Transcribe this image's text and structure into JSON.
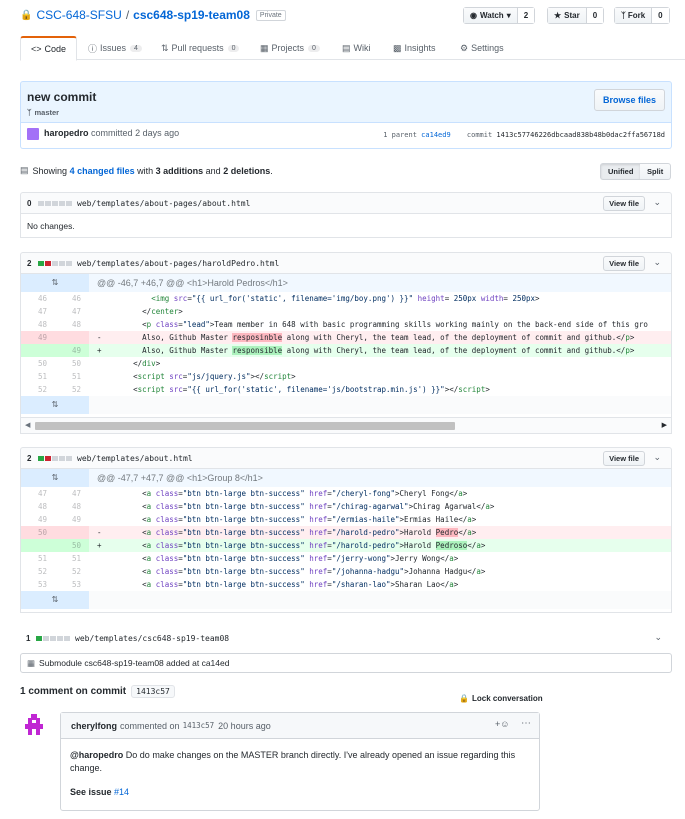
{
  "repo": {
    "owner": "CSC-648-SFSU",
    "sep": "/",
    "name": "csc648-sp19-team08",
    "visibility": "Private"
  },
  "actions": {
    "watch_label": "Watch",
    "watch_count": "2",
    "star_label": "Star",
    "star_count": "0",
    "fork_label": "Fork",
    "fork_count": "0"
  },
  "tabs": [
    {
      "label": "Code",
      "count": ""
    },
    {
      "label": "Issues",
      "count": "4"
    },
    {
      "label": "Pull requests",
      "count": "0"
    },
    {
      "label": "Projects",
      "count": "0"
    },
    {
      "label": "Wiki",
      "count": ""
    },
    {
      "label": "Insights",
      "count": ""
    },
    {
      "label": "Settings",
      "count": ""
    }
  ],
  "commit": {
    "title": "new commit",
    "branch": "master",
    "browse_label": "Browse files",
    "author": "haropedro",
    "committed_text": "committed",
    "time": "2 days ago",
    "parent_text": "1 parent",
    "parent_sha": "ca14ed9",
    "commit_label": "commit",
    "sha": "1413c57746226dbcaad838b48b0dac2ffa56718d"
  },
  "summary": {
    "showing": "Showing",
    "changed": "4 changed files",
    "with": "with",
    "additions": "3 additions",
    "and": "and",
    "deletions": "2 deletions",
    "end": "."
  },
  "view_toggle": {
    "unified": "Unified",
    "split": "Split"
  },
  "view_file_label": "View file",
  "files": [
    {
      "count": "0",
      "name": "web/templates/about-pages/about.html",
      "note": "No changes."
    },
    {
      "count": "2",
      "name": "web/templates/about-pages/haroldPedro.html",
      "hunk": "@@ -46,7 +46,7 @@ <h1>Harold Pedros</h1>"
    },
    {
      "count": "2",
      "name": "web/templates/about.html",
      "hunk": "@@ -47,7 +47,7 @@ <h1>Group 8</h1>"
    },
    {
      "count": "1",
      "name": "web/templates/csc648-sp19-team08",
      "note": "Submodule csc648-sp19-team08 added at ca14ed"
    }
  ],
  "comments": {
    "heading": "1 comment on commit",
    "sha": "1413c57",
    "lock_label": "Lock conversation",
    "author": "cherylfong",
    "commented_on": "commented on",
    "sha_ref": "1413c57",
    "time": "20 hours ago",
    "mention": "@haropedro",
    "body": "Do do make changes on the MASTER branch directly. I've already opened an issue regarding this change.",
    "see_issue": "See issue",
    "issue_ref": "#14"
  },
  "colors": {
    "accent": "#0366d6",
    "add": "#28a745",
    "del": "#cb2431",
    "orange": "#e36209"
  }
}
